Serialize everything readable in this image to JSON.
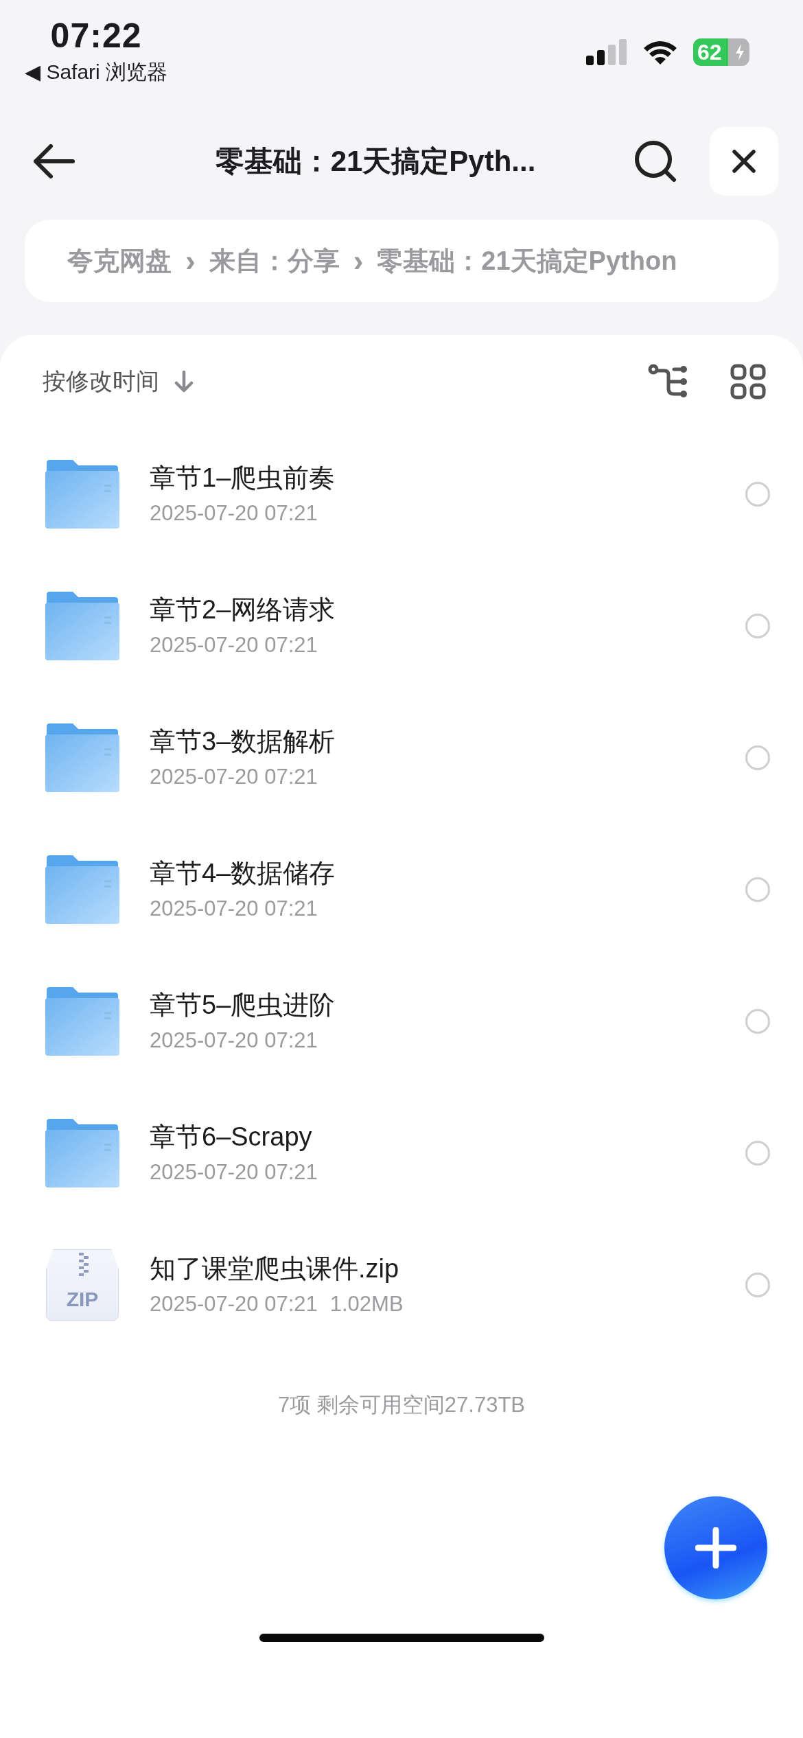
{
  "status_bar": {
    "time": "07:22",
    "back_app": "◀ Safari 浏览器",
    "battery": "62"
  },
  "header": {
    "title": "零基础：21天搞定Pyth..."
  },
  "breadcrumb": [
    {
      "label": "夸克网盘"
    },
    {
      "separator": "›",
      "label": "来自：分享"
    },
    {
      "separator": "›",
      "label": "零基础：21天搞定Python"
    }
  ],
  "sort": {
    "label": "按修改时间"
  },
  "rows": [
    {
      "kind": "folder",
      "name": "章节1–爬虫前奏",
      "date": "2025-07-20 07:21",
      "selected": false
    },
    {
      "kind": "folder",
      "name": "章节2–网络请求",
      "date": "2025-07-20 07:21",
      "selected": false
    },
    {
      "kind": "folder",
      "name": "章节3–数据解析",
      "date": "2025-07-20 07:21",
      "selected": false
    },
    {
      "kind": "folder",
      "name": "章节4–数据储存",
      "date": "2025-07-20 07:21",
      "selected": false
    },
    {
      "kind": "folder",
      "name": "章节5–爬虫进阶",
      "date": "2025-07-20 07:21",
      "selected": false
    },
    {
      "kind": "folder",
      "name": "章节6–Scrapy",
      "date": "2025-07-20 07:21",
      "selected": false
    },
    {
      "kind": "zip",
      "name": "知了课堂爬虫课件.zip",
      "date": "2025-07-20 07:21",
      "size": "1.02MB",
      "badge": "ZIP",
      "selected": false
    }
  ],
  "footer": "7项 剩余可用空间27.73TB"
}
